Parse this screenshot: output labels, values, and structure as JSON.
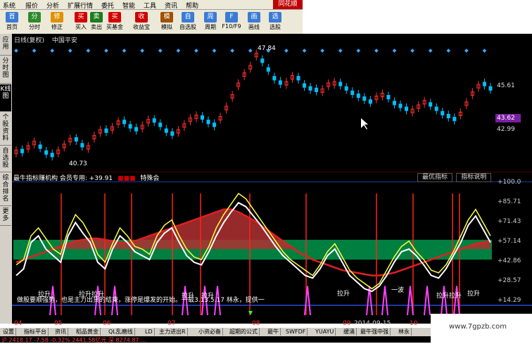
{
  "menu": [
    "系统",
    "报价",
    "分析",
    "扩展行情",
    "委托",
    "智能",
    "工具",
    "资讯",
    "帮助"
  ],
  "brand": "同花顺",
  "toolbar": [
    {
      "label": "首页",
      "icon": "home-icon",
      "color": "#3a7bd5"
    },
    {
      "label": "分时",
      "icon": "minute-chart-icon",
      "color": "#2d8a2d"
    },
    {
      "label": "修正",
      "icon": "correct-icon",
      "color": "#e09000"
    },
    {
      "label": "买入",
      "icon": "buy-icon",
      "color": "#d40000"
    },
    {
      "label": "卖出",
      "icon": "sell-icon",
      "color": "#1e7b1e"
    },
    {
      "label": "买基金",
      "icon": "buy-fund-icon",
      "color": "#d40000"
    },
    {
      "label": "收益宝",
      "icon": "profit-icon",
      "color": "#cc0000"
    },
    {
      "label": "模拟",
      "icon": "simulate-icon",
      "color": "#a05000"
    },
    {
      "label": "自选股",
      "icon": "watchlist-icon",
      "color": "#3a7bd5"
    },
    {
      "label": "周期",
      "icon": "period-icon",
      "color": "#3a7bd5"
    },
    {
      "label": "F10/F9",
      "icon": "f10-icon",
      "color": "#3a7bd5"
    },
    {
      "label": "画线",
      "icon": "draw-line-icon",
      "color": "#3a7bd5"
    },
    {
      "label": "选股",
      "icon": "stock-pick-icon",
      "color": "#3a7bd5"
    }
  ],
  "left_tabs": [
    "应用",
    "分时图",
    "K线图",
    "个股资料",
    "自选股",
    "综合排名",
    "更多"
  ],
  "chart_title": {
    "period": "日线(复权)",
    "name": "中国平安"
  },
  "price_labels": {
    "high": "47.84",
    "low": "40.73",
    "p1": "45.61",
    "p2": "43.62",
    "p3": "42.99"
  },
  "indicator_bar": {
    "text": "最牛指标赚机构 会员专用: +39.91",
    "tag": "特殊会",
    "btn1": "最优指标",
    "btn2": "指标说明"
  },
  "ind_axis": [
    "+100.0",
    "+85.71",
    "+71.43",
    "+57.14",
    "+42.86",
    "+28.57",
    "+14.29"
  ],
  "annotations": [
    "拉升",
    "拉升拉升",
    "拉升",
    "拉升",
    "拉升",
    "一波",
    "拉升拉升",
    "拉升"
  ],
  "ind_note": "做股要顺强势，也是主力出货的结束，涨停是爆发的开始。一载3.13.5.17 林永，提供一",
  "dates": [
    "04",
    "05",
    "06",
    "07",
    "08",
    "09",
    "10",
    "2014-09-15"
  ],
  "bottom_tabs": [
    "设置",
    "指标平台",
    "资讯",
    "稻品黄金",
    "QL乱磨线",
    "LD",
    "主力进出R",
    "小资必备",
    "超期的公式",
    "最牛",
    "SWFDF",
    "YUAYU",
    "缓涌",
    "最牛强中强",
    "林永"
  ],
  "status": "沪 2418.17  -7.58  -0.32%  2441.58亿元  深 8274.87 ...",
  "watermark": "www.7gpzb.com",
  "chart_data": {
    "type": "line",
    "title": "中国平安 日线(复权)",
    "xlabel": "",
    "ylabel": "",
    "candles_mid": [
      41.2,
      41.0,
      41.5,
      41.8,
      41.3,
      40.9,
      40.73,
      41.2,
      41.6,
      42.0,
      41.8,
      41.4,
      41.5,
      42.2,
      42.6,
      42.4,
      42.8,
      43.2,
      43.0,
      42.7,
      42.5,
      42.9,
      43.3,
      43.1,
      42.8,
      42.4,
      42.2,
      42.6,
      43.0,
      43.4,
      43.6,
      43.3,
      43.0,
      42.8,
      43.5,
      44.2,
      45.0,
      45.8,
      46.5,
      47.0,
      47.84,
      47.2,
      46.6,
      46.0,
      45.7,
      45.9,
      46.3,
      46.0,
      45.5,
      45.3,
      45.2,
      45.4,
      45.8,
      45.9,
      45.6,
      45.3,
      45.0,
      44.8,
      44.6,
      44.4,
      44.9,
      45.1,
      44.7,
      44.3,
      44.1,
      43.9,
      44.0,
      44.3,
      44.6,
      44.2,
      43.9,
      43.6,
      43.4,
      43.2,
      43.8,
      44.5,
      45.2,
      45.7,
      45.6,
      45.3
    ],
    "indicator_white": [
      30,
      35,
      55,
      60,
      50,
      45,
      40,
      60,
      70,
      62,
      55,
      40,
      35,
      50,
      60,
      55,
      48,
      45,
      42,
      55,
      62,
      66,
      55,
      45,
      40,
      38,
      48,
      60,
      70,
      78,
      85,
      82,
      75,
      68,
      60,
      52,
      45,
      40,
      35,
      30,
      28,
      35,
      45,
      50,
      40,
      30,
      25,
      20,
      18,
      22,
      30,
      40,
      48,
      50,
      45,
      38,
      30,
      28,
      35,
      45,
      55,
      68,
      75,
      65,
      55
    ],
    "indicator_yellow": [
      38,
      42,
      60,
      66,
      58,
      50,
      46,
      64,
      76,
      70,
      60,
      46,
      40,
      54,
      66,
      60,
      52,
      50,
      46,
      60,
      68,
      72,
      60,
      50,
      44,
      42,
      52,
      66,
      76,
      84,
      92,
      88,
      80,
      72,
      64,
      56,
      48,
      42,
      38,
      34,
      30,
      38,
      48,
      54,
      44,
      34,
      28,
      24,
      20,
      24,
      34,
      44,
      52,
      56,
      48,
      42,
      34,
      32,
      38,
      48,
      60,
      72,
      80,
      70,
      60
    ],
    "indicator_red": [
      40,
      42,
      44,
      46,
      48,
      50,
      52,
      54,
      56,
      57,
      58,
      58,
      57,
      56,
      55,
      55,
      56,
      58,
      60,
      62,
      64,
      66,
      68,
      70,
      72,
      74,
      76,
      78,
      80,
      80,
      78,
      75,
      72,
      68,
      64,
      60,
      56,
      52,
      48,
      45,
      42,
      40,
      38,
      36,
      34,
      33,
      32,
      31,
      30,
      30,
      31,
      32,
      34,
      36,
      38,
      40,
      42,
      44,
      46,
      48,
      50,
      52,
      54,
      55,
      56
    ],
    "ylim_price": [
      40,
      48.5
    ],
    "ylim_indicator": [
      0,
      100
    ]
  }
}
